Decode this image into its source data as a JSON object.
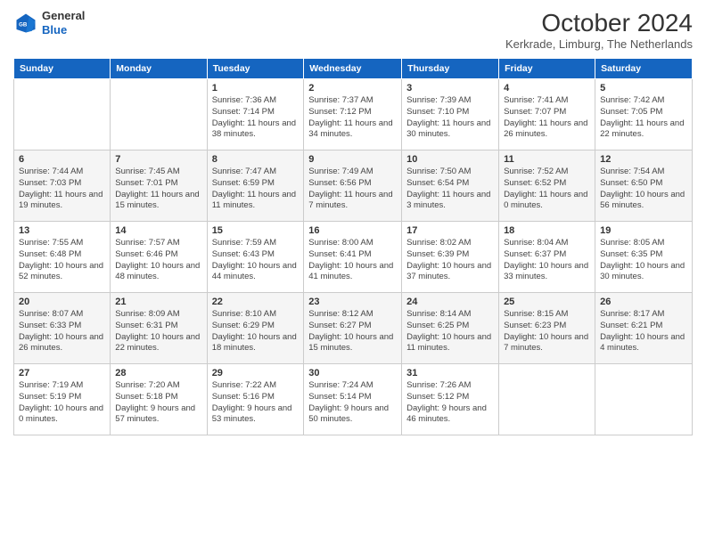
{
  "header": {
    "logo_line1": "General",
    "logo_line2": "Blue",
    "month": "October 2024",
    "location": "Kerkrade, Limburg, The Netherlands"
  },
  "weekdays": [
    "Sunday",
    "Monday",
    "Tuesday",
    "Wednesday",
    "Thursday",
    "Friday",
    "Saturday"
  ],
  "weeks": [
    [
      {
        "day": "",
        "info": ""
      },
      {
        "day": "",
        "info": ""
      },
      {
        "day": "1",
        "info": "Sunrise: 7:36 AM\nSunset: 7:14 PM\nDaylight: 11 hours and 38 minutes."
      },
      {
        "day": "2",
        "info": "Sunrise: 7:37 AM\nSunset: 7:12 PM\nDaylight: 11 hours and 34 minutes."
      },
      {
        "day": "3",
        "info": "Sunrise: 7:39 AM\nSunset: 7:10 PM\nDaylight: 11 hours and 30 minutes."
      },
      {
        "day": "4",
        "info": "Sunrise: 7:41 AM\nSunset: 7:07 PM\nDaylight: 11 hours and 26 minutes."
      },
      {
        "day": "5",
        "info": "Sunrise: 7:42 AM\nSunset: 7:05 PM\nDaylight: 11 hours and 22 minutes."
      }
    ],
    [
      {
        "day": "6",
        "info": "Sunrise: 7:44 AM\nSunset: 7:03 PM\nDaylight: 11 hours and 19 minutes."
      },
      {
        "day": "7",
        "info": "Sunrise: 7:45 AM\nSunset: 7:01 PM\nDaylight: 11 hours and 15 minutes."
      },
      {
        "day": "8",
        "info": "Sunrise: 7:47 AM\nSunset: 6:59 PM\nDaylight: 11 hours and 11 minutes."
      },
      {
        "day": "9",
        "info": "Sunrise: 7:49 AM\nSunset: 6:56 PM\nDaylight: 11 hours and 7 minutes."
      },
      {
        "day": "10",
        "info": "Sunrise: 7:50 AM\nSunset: 6:54 PM\nDaylight: 11 hours and 3 minutes."
      },
      {
        "day": "11",
        "info": "Sunrise: 7:52 AM\nSunset: 6:52 PM\nDaylight: 11 hours and 0 minutes."
      },
      {
        "day": "12",
        "info": "Sunrise: 7:54 AM\nSunset: 6:50 PM\nDaylight: 10 hours and 56 minutes."
      }
    ],
    [
      {
        "day": "13",
        "info": "Sunrise: 7:55 AM\nSunset: 6:48 PM\nDaylight: 10 hours and 52 minutes."
      },
      {
        "day": "14",
        "info": "Sunrise: 7:57 AM\nSunset: 6:46 PM\nDaylight: 10 hours and 48 minutes."
      },
      {
        "day": "15",
        "info": "Sunrise: 7:59 AM\nSunset: 6:43 PM\nDaylight: 10 hours and 44 minutes."
      },
      {
        "day": "16",
        "info": "Sunrise: 8:00 AM\nSunset: 6:41 PM\nDaylight: 10 hours and 41 minutes."
      },
      {
        "day": "17",
        "info": "Sunrise: 8:02 AM\nSunset: 6:39 PM\nDaylight: 10 hours and 37 minutes."
      },
      {
        "day": "18",
        "info": "Sunrise: 8:04 AM\nSunset: 6:37 PM\nDaylight: 10 hours and 33 minutes."
      },
      {
        "day": "19",
        "info": "Sunrise: 8:05 AM\nSunset: 6:35 PM\nDaylight: 10 hours and 30 minutes."
      }
    ],
    [
      {
        "day": "20",
        "info": "Sunrise: 8:07 AM\nSunset: 6:33 PM\nDaylight: 10 hours and 26 minutes."
      },
      {
        "day": "21",
        "info": "Sunrise: 8:09 AM\nSunset: 6:31 PM\nDaylight: 10 hours and 22 minutes."
      },
      {
        "day": "22",
        "info": "Sunrise: 8:10 AM\nSunset: 6:29 PM\nDaylight: 10 hours and 18 minutes."
      },
      {
        "day": "23",
        "info": "Sunrise: 8:12 AM\nSunset: 6:27 PM\nDaylight: 10 hours and 15 minutes."
      },
      {
        "day": "24",
        "info": "Sunrise: 8:14 AM\nSunset: 6:25 PM\nDaylight: 10 hours and 11 minutes."
      },
      {
        "day": "25",
        "info": "Sunrise: 8:15 AM\nSunset: 6:23 PM\nDaylight: 10 hours and 7 minutes."
      },
      {
        "day": "26",
        "info": "Sunrise: 8:17 AM\nSunset: 6:21 PM\nDaylight: 10 hours and 4 minutes."
      }
    ],
    [
      {
        "day": "27",
        "info": "Sunrise: 7:19 AM\nSunset: 5:19 PM\nDaylight: 10 hours and 0 minutes."
      },
      {
        "day": "28",
        "info": "Sunrise: 7:20 AM\nSunset: 5:18 PM\nDaylight: 9 hours and 57 minutes."
      },
      {
        "day": "29",
        "info": "Sunrise: 7:22 AM\nSunset: 5:16 PM\nDaylight: 9 hours and 53 minutes."
      },
      {
        "day": "30",
        "info": "Sunrise: 7:24 AM\nSunset: 5:14 PM\nDaylight: 9 hours and 50 minutes."
      },
      {
        "day": "31",
        "info": "Sunrise: 7:26 AM\nSunset: 5:12 PM\nDaylight: 9 hours and 46 minutes."
      },
      {
        "day": "",
        "info": ""
      },
      {
        "day": "",
        "info": ""
      }
    ]
  ]
}
